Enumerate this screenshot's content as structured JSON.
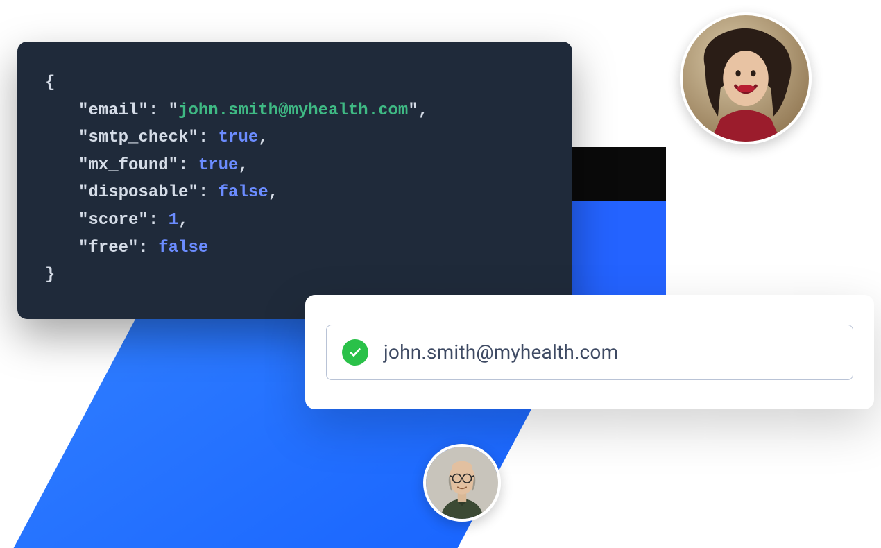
{
  "code": {
    "brace_open": "{",
    "brace_close": "}",
    "colon": ":",
    "comma": ",",
    "quote": "\"",
    "fields": {
      "email_key": "email",
      "email_val": "john.smith@myhealth.com",
      "smtp_key": "smtp_check",
      "smtp_val": "true",
      "mx_key": "mx_found",
      "mx_val": "true",
      "disposable_key": "disposable",
      "disposable_val": "false",
      "score_key": "score",
      "score_val": "1",
      "free_key": "free",
      "free_val": "false"
    }
  },
  "input": {
    "value": "john.smith@myhealth.com",
    "status": "valid"
  },
  "colors": {
    "code_bg": "#1f2a3a",
    "string": "#3fb984",
    "boolean": "#6b8cff",
    "accent_blue": "#2463ff",
    "check_green": "#2ac149"
  }
}
